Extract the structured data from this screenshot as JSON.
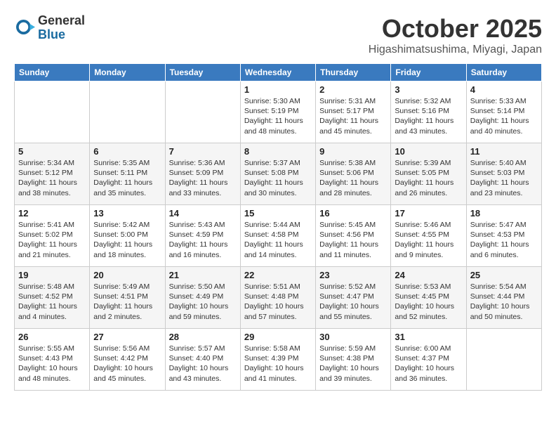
{
  "logo": {
    "general": "General",
    "blue": "Blue"
  },
  "title": "October 2025",
  "location": "Higashimatsushima, Miyagi, Japan",
  "days_of_week": [
    "Sunday",
    "Monday",
    "Tuesday",
    "Wednesday",
    "Thursday",
    "Friday",
    "Saturday"
  ],
  "weeks": [
    [
      {
        "day": "",
        "info": ""
      },
      {
        "day": "",
        "info": ""
      },
      {
        "day": "",
        "info": ""
      },
      {
        "day": "1",
        "info": "Sunrise: 5:30 AM\nSunset: 5:19 PM\nDaylight: 11 hours and 48 minutes."
      },
      {
        "day": "2",
        "info": "Sunrise: 5:31 AM\nSunset: 5:17 PM\nDaylight: 11 hours and 45 minutes."
      },
      {
        "day": "3",
        "info": "Sunrise: 5:32 AM\nSunset: 5:16 PM\nDaylight: 11 hours and 43 minutes."
      },
      {
        "day": "4",
        "info": "Sunrise: 5:33 AM\nSunset: 5:14 PM\nDaylight: 11 hours and 40 minutes."
      }
    ],
    [
      {
        "day": "5",
        "info": "Sunrise: 5:34 AM\nSunset: 5:12 PM\nDaylight: 11 hours and 38 minutes."
      },
      {
        "day": "6",
        "info": "Sunrise: 5:35 AM\nSunset: 5:11 PM\nDaylight: 11 hours and 35 minutes."
      },
      {
        "day": "7",
        "info": "Sunrise: 5:36 AM\nSunset: 5:09 PM\nDaylight: 11 hours and 33 minutes."
      },
      {
        "day": "8",
        "info": "Sunrise: 5:37 AM\nSunset: 5:08 PM\nDaylight: 11 hours and 30 minutes."
      },
      {
        "day": "9",
        "info": "Sunrise: 5:38 AM\nSunset: 5:06 PM\nDaylight: 11 hours and 28 minutes."
      },
      {
        "day": "10",
        "info": "Sunrise: 5:39 AM\nSunset: 5:05 PM\nDaylight: 11 hours and 26 minutes."
      },
      {
        "day": "11",
        "info": "Sunrise: 5:40 AM\nSunset: 5:03 PM\nDaylight: 11 hours and 23 minutes."
      }
    ],
    [
      {
        "day": "12",
        "info": "Sunrise: 5:41 AM\nSunset: 5:02 PM\nDaylight: 11 hours and 21 minutes."
      },
      {
        "day": "13",
        "info": "Sunrise: 5:42 AM\nSunset: 5:00 PM\nDaylight: 11 hours and 18 minutes."
      },
      {
        "day": "14",
        "info": "Sunrise: 5:43 AM\nSunset: 4:59 PM\nDaylight: 11 hours and 16 minutes."
      },
      {
        "day": "15",
        "info": "Sunrise: 5:44 AM\nSunset: 4:58 PM\nDaylight: 11 hours and 14 minutes."
      },
      {
        "day": "16",
        "info": "Sunrise: 5:45 AM\nSunset: 4:56 PM\nDaylight: 11 hours and 11 minutes."
      },
      {
        "day": "17",
        "info": "Sunrise: 5:46 AM\nSunset: 4:55 PM\nDaylight: 11 hours and 9 minutes."
      },
      {
        "day": "18",
        "info": "Sunrise: 5:47 AM\nSunset: 4:53 PM\nDaylight: 11 hours and 6 minutes."
      }
    ],
    [
      {
        "day": "19",
        "info": "Sunrise: 5:48 AM\nSunset: 4:52 PM\nDaylight: 11 hours and 4 minutes."
      },
      {
        "day": "20",
        "info": "Sunrise: 5:49 AM\nSunset: 4:51 PM\nDaylight: 11 hours and 2 minutes."
      },
      {
        "day": "21",
        "info": "Sunrise: 5:50 AM\nSunset: 4:49 PM\nDaylight: 10 hours and 59 minutes."
      },
      {
        "day": "22",
        "info": "Sunrise: 5:51 AM\nSunset: 4:48 PM\nDaylight: 10 hours and 57 minutes."
      },
      {
        "day": "23",
        "info": "Sunrise: 5:52 AM\nSunset: 4:47 PM\nDaylight: 10 hours and 55 minutes."
      },
      {
        "day": "24",
        "info": "Sunrise: 5:53 AM\nSunset: 4:45 PM\nDaylight: 10 hours and 52 minutes."
      },
      {
        "day": "25",
        "info": "Sunrise: 5:54 AM\nSunset: 4:44 PM\nDaylight: 10 hours and 50 minutes."
      }
    ],
    [
      {
        "day": "26",
        "info": "Sunrise: 5:55 AM\nSunset: 4:43 PM\nDaylight: 10 hours and 48 minutes."
      },
      {
        "day": "27",
        "info": "Sunrise: 5:56 AM\nSunset: 4:42 PM\nDaylight: 10 hours and 45 minutes."
      },
      {
        "day": "28",
        "info": "Sunrise: 5:57 AM\nSunset: 4:40 PM\nDaylight: 10 hours and 43 minutes."
      },
      {
        "day": "29",
        "info": "Sunrise: 5:58 AM\nSunset: 4:39 PM\nDaylight: 10 hours and 41 minutes."
      },
      {
        "day": "30",
        "info": "Sunrise: 5:59 AM\nSunset: 4:38 PM\nDaylight: 10 hours and 39 minutes."
      },
      {
        "day": "31",
        "info": "Sunrise: 6:00 AM\nSunset: 4:37 PM\nDaylight: 10 hours and 36 minutes."
      },
      {
        "day": "",
        "info": ""
      }
    ]
  ]
}
